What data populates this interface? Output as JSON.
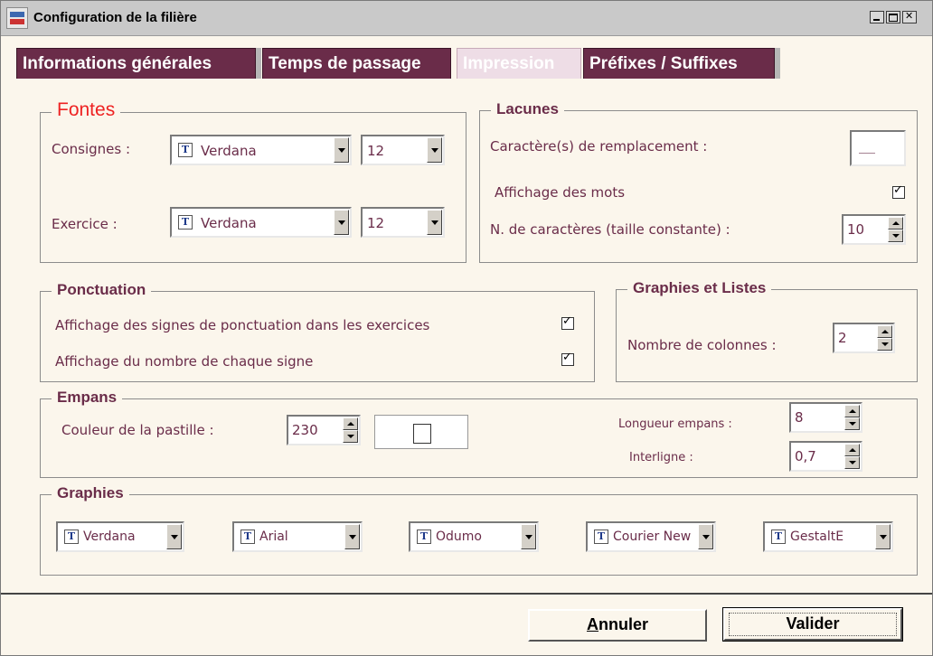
{
  "window": {
    "title": "Configuration de la filière"
  },
  "tabs": [
    {
      "label": "Informations générales"
    },
    {
      "label": "Temps de passage"
    },
    {
      "label": "Impression"
    },
    {
      "label": "Préfixes / Suffixes"
    }
  ],
  "fontes": {
    "legend": "Fontes",
    "consignes_label": "Consignes :",
    "consignes_font": "Verdana",
    "consignes_size": "12",
    "exercice_label": "Exercice :",
    "exercice_font": "Verdana",
    "exercice_size": "12"
  },
  "lacunes": {
    "legend": "Lacunes",
    "remplacement_label": "Caractère(s) de remplacement :",
    "remplacement_value": "__",
    "affichage_label": "Affichage des mots",
    "nb_label": "N. de caractères (taille constante) :",
    "nb_value": "10"
  },
  "ponctuation": {
    "legend": "Ponctuation",
    "signes_label": "Affichage des signes de ponctuation dans les exercices",
    "nombre_label": "Affichage du nombre de chaque signe"
  },
  "graphies_listes": {
    "legend": "Graphies et Listes",
    "colonnes_label": "Nombre de colonnes :",
    "colonnes_value": "2"
  },
  "empans": {
    "legend": "Empans",
    "couleur_label": "Couleur de la pastille :",
    "couleur_value": "230",
    "longueur_label": "Longueur empans :",
    "longueur_value": "8",
    "interligne_label": "Interligne :",
    "interligne_value": "0,7"
  },
  "graphies": {
    "legend": "Graphies",
    "fonts": [
      "Verdana",
      "Arial",
      "Odumo",
      "Courier New",
      "GestaltE"
    ]
  },
  "buttons": {
    "annuler": "nnuler",
    "annuler_mnemonic": "A",
    "valider": "Valider"
  },
  "icons": {
    "font_icon": "truetype-font-icon"
  },
  "colors": {
    "accent": "#6a2c49",
    "legend_red": "#e22222",
    "background": "#fbf6ec"
  }
}
